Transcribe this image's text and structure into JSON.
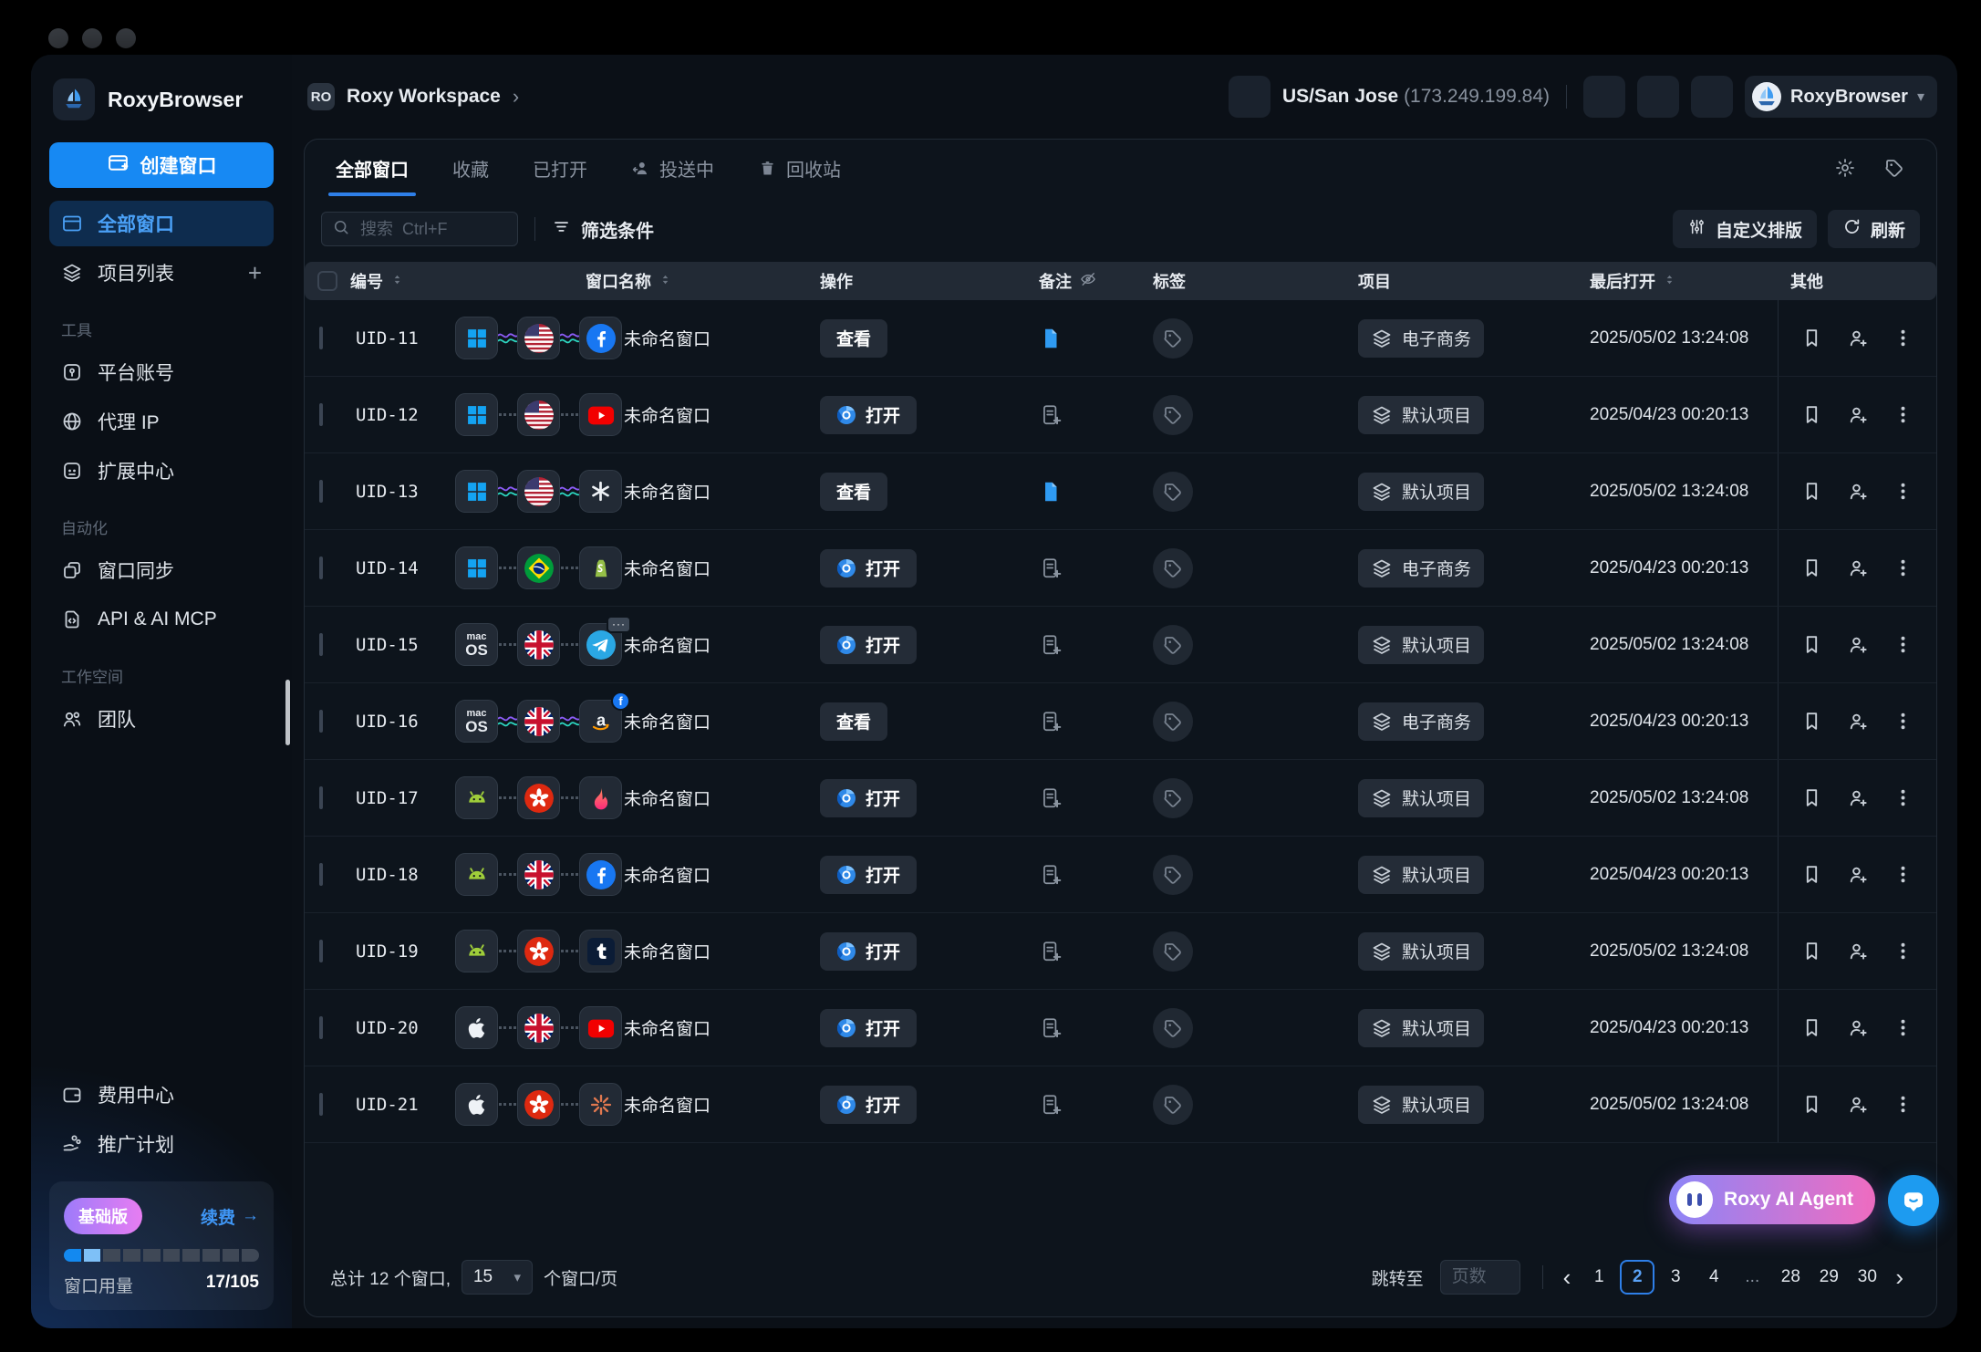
{
  "sidebar": {
    "brand": "RoxyBrowser",
    "create_button": "创建窗口",
    "top_items": [
      {
        "id": "all-windows",
        "icon": "window",
        "label": "全部窗口",
        "active": true
      },
      {
        "id": "project-list",
        "icon": "layers",
        "label": "项目列表",
        "trailing": "+"
      }
    ],
    "sections": [
      {
        "label": "工具",
        "items": [
          {
            "id": "platform-accounts",
            "icon": "key-square",
            "label": "平台账号"
          },
          {
            "id": "proxy-ip",
            "icon": "globe",
            "label": "代理 IP"
          },
          {
            "id": "extension-center",
            "icon": "extension",
            "label": "扩展中心"
          }
        ]
      },
      {
        "label": "自动化",
        "items": [
          {
            "id": "window-sync",
            "icon": "copy",
            "label": "窗口同步"
          },
          {
            "id": "api-ai-mcp",
            "icon": "code-file",
            "label": "API & AI MCP"
          }
        ]
      },
      {
        "label": "工作空间",
        "items": [
          {
            "id": "team",
            "icon": "users",
            "label": "团队"
          }
        ]
      }
    ],
    "footer_items": [
      {
        "id": "billing-center",
        "icon": "wallet",
        "label": "费用中心"
      },
      {
        "id": "referral-plan",
        "icon": "share-hand",
        "label": "推广计划"
      }
    ],
    "plan": {
      "badge": "基础版",
      "renew_label": "续费",
      "renew_arrow": "→",
      "usage_label": "窗口用量",
      "usage_value": "17/105",
      "segments_total": 10,
      "segments_full": 1,
      "segments_partial": 1
    }
  },
  "topbar": {
    "workspace_badge": "RO",
    "workspace_name": "Roxy Workspace",
    "workspace_chevron": "›",
    "ip_location": "US/San Jose",
    "ip_address": "(173.249.199.84)",
    "account_name": "RoxyBrowser"
  },
  "tabs": [
    {
      "id": "all-windows",
      "label": "全部窗口",
      "active": true
    },
    {
      "id": "favorites",
      "label": "收藏"
    },
    {
      "id": "opened",
      "label": "已打开"
    },
    {
      "id": "delivering",
      "label": "投送中",
      "icon": "person-arrow"
    },
    {
      "id": "recycle-bin",
      "label": "回收站",
      "icon": "trash"
    }
  ],
  "toolbar": {
    "search_placeholder": "搜索  Ctrl+F",
    "filter_label": "筛选条件",
    "layout_button": "自定义排版",
    "refresh_button": "刷新"
  },
  "table": {
    "headers": {
      "id": "编号",
      "name": "窗口名称",
      "action": "操作",
      "note": "备注",
      "tag": "标签",
      "project": "项目",
      "last_opened": "最后打开",
      "other": "其他"
    },
    "action_view": "查看",
    "action_open": "打开",
    "rows": [
      {
        "uid": "UID-11",
        "os": "windows",
        "flag": "us",
        "app": "facebook",
        "connector": "wavy",
        "name": "未命名窗口",
        "action": "view",
        "note": "filled",
        "project": "电子商务",
        "date": "2025/05/02 13:24:08"
      },
      {
        "uid": "UID-12",
        "os": "windows",
        "flag": "us",
        "app": "youtube",
        "connector": "dotted",
        "name": "未命名窗口",
        "action": "open",
        "note": "add",
        "project": "默认项目",
        "date": "2025/04/23 00:20:13"
      },
      {
        "uid": "UID-13",
        "os": "windows",
        "flag": "us",
        "app": "openai",
        "connector": "wavy",
        "name": "未命名窗口",
        "action": "view",
        "note": "filled",
        "project": "默认项目",
        "date": "2025/05/02 13:24:08"
      },
      {
        "uid": "UID-14",
        "os": "windows",
        "flag": "brazil",
        "app": "shopify",
        "connector": "dotted",
        "name": "未命名窗口",
        "action": "open",
        "note": "add",
        "project": "电子商务",
        "date": "2025/04/23 00:20:13"
      },
      {
        "uid": "UID-15",
        "os": "macos",
        "flag": "uk",
        "app": "telegram",
        "badge": "dots",
        "connector": "dotted",
        "name": "未命名窗口",
        "action": "open",
        "note": "add",
        "project": "默认项目",
        "date": "2025/05/02 13:24:08"
      },
      {
        "uid": "UID-16",
        "os": "macos",
        "flag": "uk",
        "app": "amazon",
        "badge": "facebook",
        "connector": "wavy",
        "name": "未命名窗口",
        "action": "view",
        "note": "add",
        "project": "电子商务",
        "date": "2025/04/23 00:20:13"
      },
      {
        "uid": "UID-17",
        "os": "android",
        "flag": "hk",
        "app": "tinder",
        "connector": "dotted",
        "name": "未命名窗口",
        "action": "open",
        "note": "add",
        "project": "默认项目",
        "date": "2025/05/02 13:24:08"
      },
      {
        "uid": "UID-18",
        "os": "android",
        "flag": "uk",
        "app": "facebook",
        "connector": "dotted",
        "name": "未命名窗口",
        "action": "open",
        "note": "add",
        "project": "默认项目",
        "date": "2025/04/23 00:20:13"
      },
      {
        "uid": "UID-19",
        "os": "android",
        "flag": "hk",
        "app": "tumblr",
        "connector": "dotted",
        "name": "未命名窗口",
        "action": "open",
        "note": "add",
        "project": "默认项目",
        "date": "2025/05/02 13:24:08"
      },
      {
        "uid": "UID-20",
        "os": "apple",
        "flag": "uk",
        "app": "youtube",
        "connector": "dotted",
        "name": "未命名窗口",
        "action": "open",
        "note": "add",
        "project": "默认项目",
        "date": "2025/04/23 00:20:13"
      },
      {
        "uid": "UID-21",
        "os": "apple",
        "flag": "hk",
        "app": "starburst",
        "connector": "dotted",
        "name": "未命名窗口",
        "action": "open",
        "note": "add",
        "project": "默认项目",
        "date": "2025/05/02 13:24:08"
      }
    ]
  },
  "footer": {
    "total_text": "总计 12 个窗口,",
    "page_size": "15",
    "per_page_suffix": "个窗口/页",
    "jump_label": "跳转至",
    "jump_placeholder": "页数",
    "pages": [
      "1",
      "2",
      "3",
      "4",
      "...",
      "28",
      "29",
      "30"
    ],
    "active_page": "2"
  },
  "floating": {
    "ai_agent_label": "Roxy AI Agent"
  },
  "colors": {
    "accent_blue": "#1789f3",
    "active_item_bg": "#0e2c4e",
    "active_tab_underline": "#2e7fe8",
    "plan_badge_gradient": [
      "#9d7bfa",
      "#e77df2"
    ],
    "ai_gradient": [
      "#8d85f7",
      "#ef6cc0"
    ],
    "chat_bubble": "#1d9bf0",
    "usage_full": "#1389f0",
    "usage_partial": "#7ec0f7"
  }
}
